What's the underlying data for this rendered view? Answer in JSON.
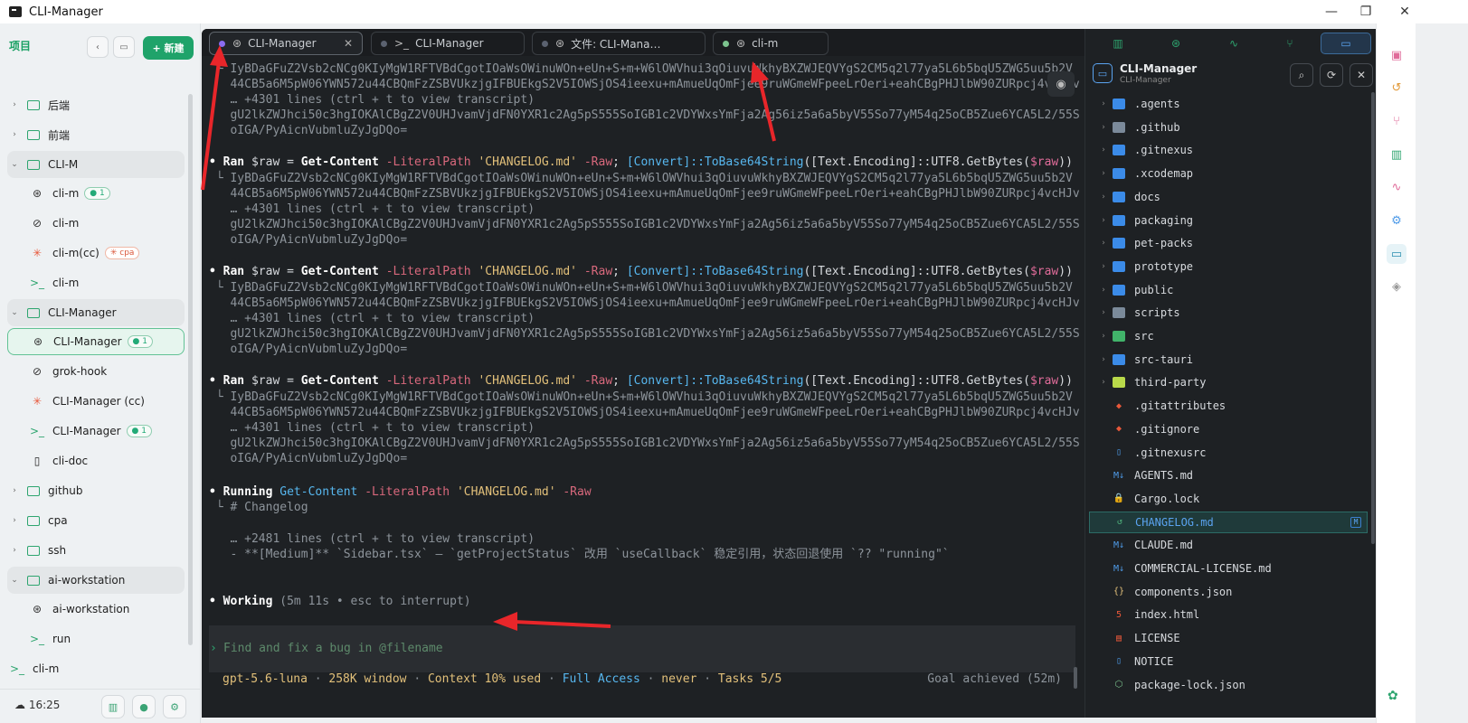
{
  "window": {
    "title": "CLI-Manager"
  },
  "sidebar": {
    "title": "项目",
    "new_label": "+ 新建",
    "rows": [
      {
        "kind": "group",
        "collapsed": true,
        "icon": "folder",
        "label": "后端"
      },
      {
        "kind": "group",
        "collapsed": true,
        "icon": "folder",
        "label": "前端"
      },
      {
        "kind": "group",
        "collapsed": false,
        "icon": "folder",
        "label": "CLI-M"
      },
      {
        "kind": "item",
        "icon": "openai",
        "label": "cli-m",
        "badge": "● 1"
      },
      {
        "kind": "item",
        "icon": "grok",
        "label": "cli-m"
      },
      {
        "kind": "item",
        "icon": "claude",
        "label": "cli-m(cc)",
        "badge": "✳ cpa",
        "badge_style": "orange"
      },
      {
        "kind": "item",
        "icon": "terminal",
        "label": "cli-m"
      },
      {
        "kind": "group",
        "collapsed": false,
        "icon": "folder",
        "label": "CLI-Manager"
      },
      {
        "kind": "item",
        "icon": "openai",
        "label": "CLI-Manager",
        "badge": "● 1",
        "selected": true
      },
      {
        "kind": "item",
        "icon": "grok",
        "label": "grok-hook"
      },
      {
        "kind": "item",
        "icon": "claude",
        "label": "CLI-Manager (cc)"
      },
      {
        "kind": "item",
        "icon": "terminal",
        "label": "CLI-Manager",
        "badge": "● 1"
      },
      {
        "kind": "item",
        "icon": "doc",
        "label": "cli-doc"
      },
      {
        "kind": "group",
        "collapsed": true,
        "icon": "folder",
        "label": "github"
      },
      {
        "kind": "group",
        "collapsed": true,
        "icon": "folder",
        "label": "cpa"
      },
      {
        "kind": "group",
        "collapsed": true,
        "icon": "folder",
        "label": "ssh"
      },
      {
        "kind": "group",
        "collapsed": false,
        "icon": "folder",
        "label": "ai-workstation"
      },
      {
        "kind": "item",
        "icon": "openai",
        "label": "ai-workstation"
      },
      {
        "kind": "item",
        "icon": "terminal",
        "label": "run"
      },
      {
        "kind": "root",
        "icon": "terminal",
        "label": "cli-m"
      }
    ],
    "clock": "16:25"
  },
  "tabs": [
    {
      "label": "CLI-Manager",
      "dot": "#8a6cf0",
      "icon": "openai",
      "active": true,
      "closable": true
    },
    {
      "label": "CLI-Manager",
      "dot": "#5b6270",
      "icon": "terminal"
    },
    {
      "label": "文件: CLI-Mana…",
      "dot": "#5b6270",
      "icon": "openai"
    },
    {
      "label": "cli-m",
      "dot": "#7cc38e",
      "icon": "openai"
    }
  ],
  "terminal": {
    "cmd": "Ran $raw = Get-Content -LiteralPath 'CHANGELOG.md' -Raw; [Convert]::ToBase64String([Text.Encoding]::UTF8.GetBytes($raw))",
    "out1": "IyBDaGFuZ2Vsb2cNCg0KIyMgW1RFTVBdCgotIOaWsOWinuWOn+eUn+S+m+W6lOWVhui3qOiuvuWkhyBXZWJEQVYgS2CM5q2l77ya5L6b5bqU5ZWG5uu5b2V",
    "out2": "44CB5a6M5pW06YWN572u44CBQmFzZSBVUkzjgIFBUEkgS2V5IOWSjOS4ieexu+mAmueUqOmFjee9ruWGmeWFpeeLrOeri+eahCBgPHJlbW90ZURpcj4vcHJv",
    "more": "… +4301 lines (ctrl + t to view transcript)",
    "out3": "gU2lkZWJhci50c3hgIOKAlCBgZ2V0UHJvamVjdFN0YXR1c2Ag5pS555SoIGB1c2VDYWxsYmFja2Ag56iz5a6a5byV55So77yM54q25oCB5Zue6YCA5L2/55S",
    "out4": "oIGA/PyAicnVubmluZyJgDQo=",
    "running_cmd": "Running Get-Content -LiteralPath 'CHANGELOG.md' -Raw",
    "running_out1": "# Changelog",
    "running_more": "… +2481 lines (ctrl + t to view transcript)",
    "running_out2": "- **[Medium]** `Sidebar.tsx` — `getProjectStatus` 改用 `useCallback` 稳定引用，状态回退使用 `?? \"running\"`",
    "working": "Working",
    "working_meta": "(5m 11s • esc to interrupt)",
    "input_placeholder": "Find and fix a bug in @filename",
    "status_model": "gpt-5.6-luna",
    "status_window": "258K window",
    "status_context": "Context 10% used",
    "status_access": "Full Access",
    "status_never": "never",
    "status_tasks": "Tasks 5/5",
    "goal": "Goal achieved (52m)"
  },
  "explorer": {
    "project": "CLI-Manager",
    "subtitle": "CLI-Manager",
    "files": [
      {
        "name": ".agents",
        "type": "dir",
        "color": "#3b8be8"
      },
      {
        "name": ".github",
        "type": "dir",
        "color": "#7b8a9a"
      },
      {
        "name": ".gitnexus",
        "type": "dir",
        "color": "#3b8be8"
      },
      {
        "name": ".xcodemap",
        "type": "dir",
        "color": "#3b8be8"
      },
      {
        "name": "docs",
        "type": "dir",
        "color": "#3b8be8"
      },
      {
        "name": "packaging",
        "type": "dir",
        "color": "#3b8be8"
      },
      {
        "name": "pet-packs",
        "type": "dir",
        "color": "#3b8be8"
      },
      {
        "name": "prototype",
        "type": "dir",
        "color": "#3b8be8"
      },
      {
        "name": "public",
        "type": "dir",
        "color": "#3b8be8"
      },
      {
        "name": "scripts",
        "type": "dir",
        "color": "#7b8a9a"
      },
      {
        "name": "src",
        "type": "dir",
        "color": "#41b36a"
      },
      {
        "name": "src-tauri",
        "type": "dir",
        "color": "#3b8be8"
      },
      {
        "name": "third-party",
        "type": "dir",
        "color": "#b9d94a"
      },
      {
        "name": ".gitattributes",
        "type": "file",
        "icon": "◆",
        "color": "#e8583a"
      },
      {
        "name": ".gitignore",
        "type": "file",
        "icon": "◆",
        "color": "#e8583a"
      },
      {
        "name": ".gitnexusrc",
        "type": "file",
        "icon": "▯",
        "color": "#4f9be8"
      },
      {
        "name": "AGENTS.md",
        "type": "file",
        "icon": "M↓",
        "color": "#4f9be8"
      },
      {
        "name": "Cargo.lock",
        "type": "file",
        "icon": "🔒",
        "color": "#e2c07a"
      },
      {
        "name": "CHANGELOG.md",
        "type": "file",
        "icon": "↺",
        "color": "#4fb27c",
        "selected": true,
        "badge": "M"
      },
      {
        "name": "CLAUDE.md",
        "type": "file",
        "icon": "M↓",
        "color": "#4f9be8"
      },
      {
        "name": "COMMERCIAL-LICENSE.md",
        "type": "file",
        "icon": "M↓",
        "color": "#4f9be8"
      },
      {
        "name": "components.json",
        "type": "file",
        "icon": "{}",
        "color": "#e2c07a"
      },
      {
        "name": "index.html",
        "type": "file",
        "icon": "5",
        "color": "#e8583a"
      },
      {
        "name": "LICENSE",
        "type": "file",
        "icon": "▤",
        "color": "#e8583a"
      },
      {
        "name": "NOTICE",
        "type": "file",
        "icon": "▯",
        "color": "#4f9be8"
      },
      {
        "name": "package-lock.json",
        "type": "file",
        "icon": "⬡",
        "color": "#7cc38e"
      }
    ]
  }
}
